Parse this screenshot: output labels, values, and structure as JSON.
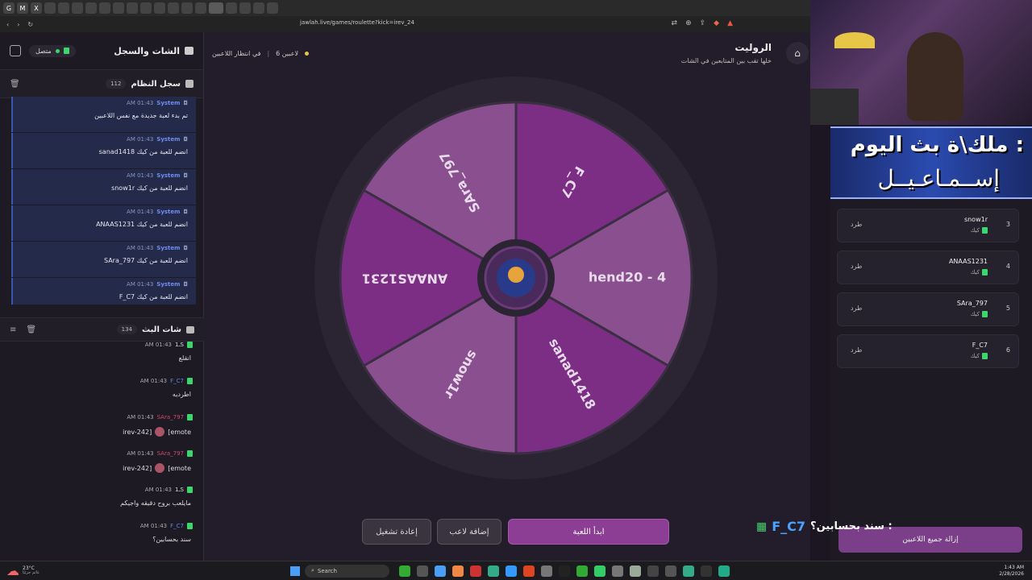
{
  "browser": {
    "url": "jawlah.live/games/roulette?kick=irev_24",
    "tabs": [
      "G",
      "M",
      "X",
      "",
      "",
      "",
      "",
      "",
      "",
      "",
      "",
      "",
      "",
      "",
      "",
      "",
      "",
      "",
      "",
      ""
    ]
  },
  "left_panel": {
    "title": "الشات والسجل",
    "status": "متصل",
    "system_log": {
      "title": "سجل النظام",
      "count": "112",
      "items": [
        {
          "time": "AM 01:43",
          "sender": "System",
          "text": "تم بدء لعبة جديدة مع نفس اللاعبين"
        },
        {
          "time": "AM 01:43",
          "sender": "System",
          "text": "sanad1418 انضم للعبة من كيك"
        },
        {
          "time": "AM 01:43",
          "sender": "System",
          "text": "snow1r انضم للعبة من كيك"
        },
        {
          "time": "AM 01:43",
          "sender": "System",
          "text": "ANAAS1231 انضم للعبة من كيك"
        },
        {
          "time": "AM 01:43",
          "sender": "System",
          "text": "SAra_797 انضم للعبة من كيك"
        },
        {
          "time": "AM 01:43",
          "sender": "System",
          "text": "F_C7 انضم للعبة من كيك"
        }
      ]
    },
    "stream_chat": {
      "title": "شات البث",
      "count": "134",
      "items": [
        {
          "time": "AM 01:43",
          "user": "ـ1S",
          "user_color": "#dddddd",
          "text": "انقلع",
          "emote": ""
        },
        {
          "time": "AM 01:43",
          "user": "F_C7",
          "user_color": "#5a8ae6",
          "text": "اطرديه",
          "emote": ""
        },
        {
          "time": "AM 01:43",
          "user": "SAra_797",
          "user_color": "#d14a6a",
          "text": "[emote",
          "emote": "irev-242]"
        },
        {
          "time": "AM 01:43",
          "user": "SAra_797",
          "user_color": "#d14a6a",
          "text": "[emote",
          "emote": "irev-242]"
        },
        {
          "time": "AM 01:43",
          "user": "ـ1S",
          "user_color": "#dddddd",
          "text": "مايلعب بروح دقيقه واجيكم",
          "emote": ""
        },
        {
          "time": "AM 01:43",
          "user": "F_C7",
          "user_color": "#5a8ae6",
          "text": "سند بحسابين؟",
          "emote": ""
        }
      ]
    }
  },
  "main": {
    "title": "الروليت",
    "subtitle": "خلها تقب بين المتابعين في الشات",
    "players_count": "6 لاعبين",
    "waiting": "في انتظار اللاعبين",
    "wheel": {
      "segments": [
        {
          "label": "F_C7",
          "color": "#7c2e85"
        },
        {
          "label": "hend20 - 4",
          "color": "#8a4f8f"
        },
        {
          "label": "sanad1418",
          "color": "#7c2e85"
        },
        {
          "label": "snow1r",
          "color": "#8a4f8f"
        },
        {
          "label": "ANAAS1231",
          "color": "#7c2e85"
        },
        {
          "label": "SAra_797",
          "color": "#8a4f8f"
        }
      ]
    },
    "buttons": {
      "start": "ابدأ اللعبة",
      "add_player": "إضافة لاعب",
      "restart": "إعادة تشغيل"
    }
  },
  "overlay": {
    "banner_line1": "ملك\\ة بث اليوم :",
    "banner_line2": "إســمـاعـيــل",
    "chat_question": "سند بحسابين؟ :",
    "chat_user": "F_C7"
  },
  "right_panel": {
    "players": [
      {
        "num": "3",
        "name": "snow1r",
        "platform": "كيك",
        "action": "طرد"
      },
      {
        "num": "4",
        "name": "ANAAS1231",
        "platform": "كيك",
        "action": "طرد"
      },
      {
        "num": "5",
        "name": "SAra_797",
        "platform": "كيك",
        "action": "طرد"
      },
      {
        "num": "6",
        "name": "F_C7",
        "platform": "كيك",
        "action": "طرد"
      }
    ],
    "remove_all": "إزالة جميع اللاعبين"
  },
  "taskbar": {
    "weather": "23°C",
    "weather_sub": "غائم جزئيًا",
    "search": "Search",
    "time": "1:43 AM",
    "date": "2/28/2026"
  }
}
